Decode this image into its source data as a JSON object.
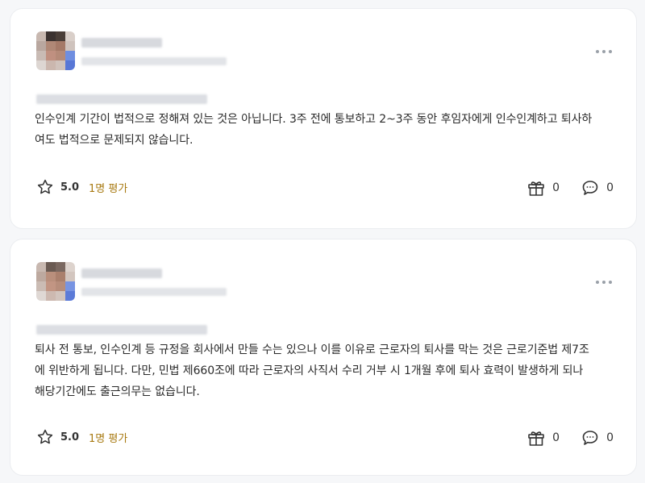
{
  "more_icon": "more-horizontal-icon",
  "star_icon": "star-outline-icon",
  "gift_icon": "gift-icon",
  "comment_icon": "comment-icon",
  "accent_color": "#a87a12",
  "posts": [
    {
      "body": "인수인계 기간이 법적으로 정해져 있는 것은 아닙니다. 3주 전에 통보하고 2~3주 동안 후임자에게 인수인계하고 퇴사하\n여도 법적으로 문제되지 않습니다.",
      "score": "5.0",
      "rating_count": "1명 평가",
      "gifts": "0",
      "comments": "0"
    },
    {
      "body": "퇴사 전 통보, 인수인계 등 규정을 회사에서 만들 수는 있으나 이를 이유로 근로자의 퇴사를 막는 것은 근로기준법 제7조\n에 위반하게 됩니다. 다만, 민법 제660조에 따라 근로자의 사직서 수리 거부 시 1개월 후에 퇴사 효력이 발생하게 되나\n해당기간에도 출근의무는 없습니다.",
      "score": "5.0",
      "rating_count": "1명 평가",
      "gifts": "0",
      "comments": "0"
    }
  ]
}
